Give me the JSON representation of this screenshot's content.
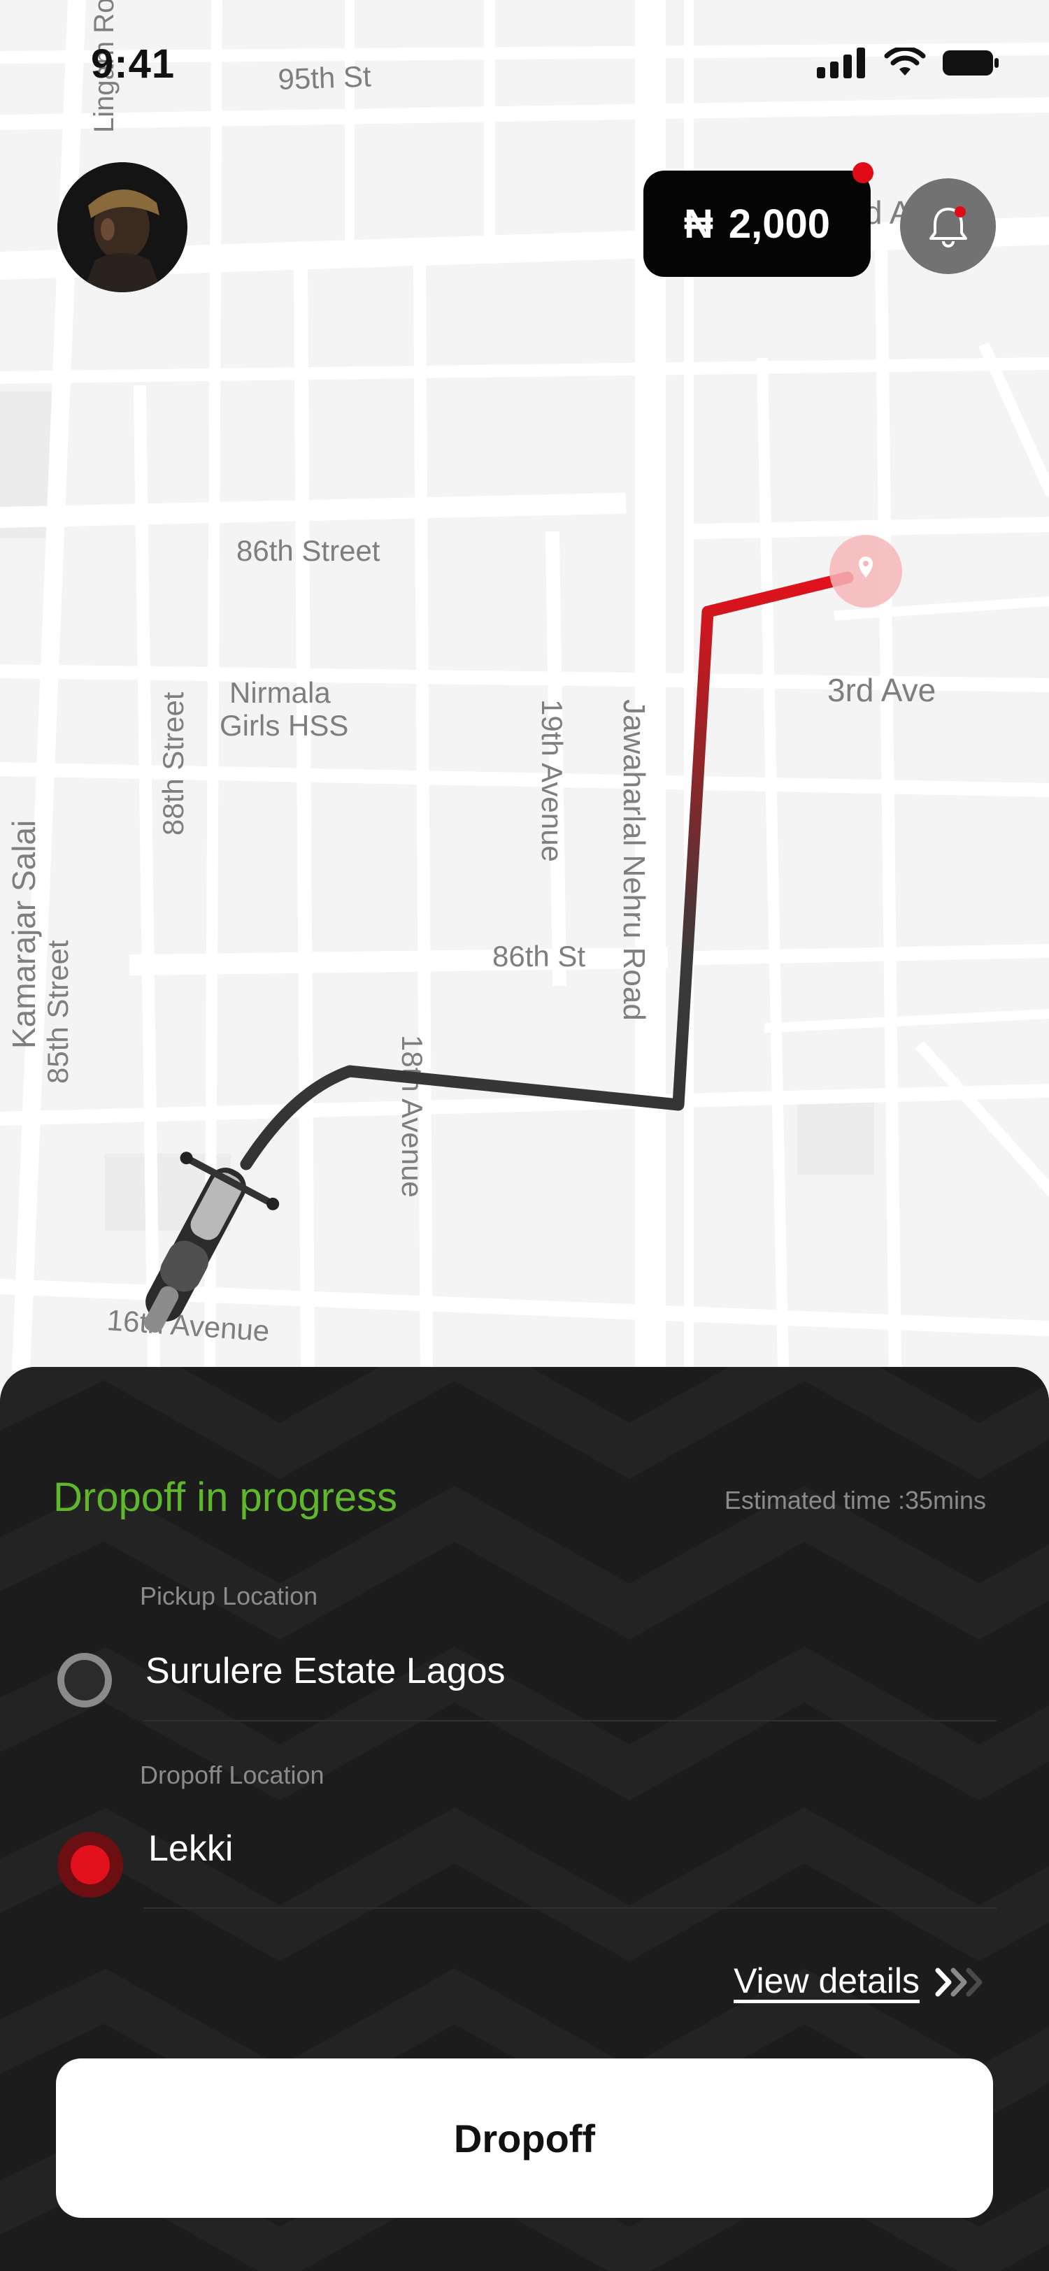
{
  "status_bar": {
    "time": "9:41"
  },
  "map": {
    "labels": {
      "lingam_road": "Lingam Ro",
      "st95": "95th St",
      "st86_top": "86th Street",
      "nirmala_1": "Nirmala",
      "nirmala_2": "Girls HSS",
      "street88": "88th Street",
      "avenue19": "19th Avenue",
      "jawaharlal": "Jawaharlal Nehru Road",
      "ave3rd": "3rd Ave",
      "ave3rd_top": "d Ave",
      "salai": "Kamarajar Salai",
      "street85": "85th Street",
      "st86_mid": "86th St",
      "avenue18": "18th Avenue",
      "avenue16": "16th Avenue"
    }
  },
  "header": {
    "balance": "2,000",
    "currency_symbol": "₦"
  },
  "trip": {
    "status": "Dropoff in progress",
    "eta": "Estimated time :35mins",
    "pickup_label": "Pickup Location",
    "pickup_value": "Surulere Estate Lagos",
    "dropoff_label": "Dropoff Location",
    "dropoff_value": "Lekki",
    "view_details": "View details"
  },
  "actions": {
    "primary": "Dropoff"
  },
  "colors": {
    "accent_green": "#5fb72a",
    "route_red": "#e1121b",
    "sheet_bg": "#1c1c1c",
    "alert_red": "#e10a17"
  }
}
